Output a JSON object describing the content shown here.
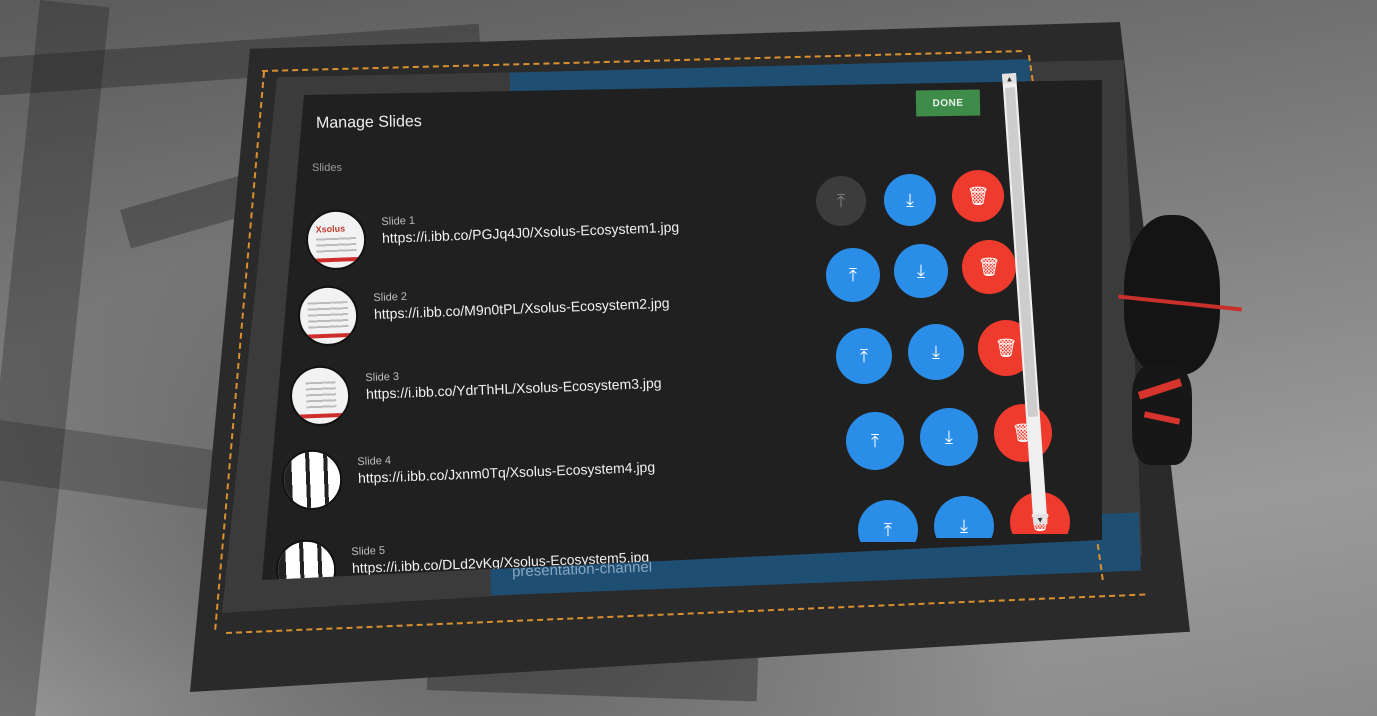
{
  "panel": {
    "title": "Manage Slides",
    "section_label": "Slides",
    "done_label": "DONE"
  },
  "channel_label": "presentation-channel",
  "slides": [
    {
      "name": "Slide 1",
      "url": "https://i.ibb.co/PGJq4J0/Xsolus-Ecosystem1.jpg",
      "move_up_enabled": false
    },
    {
      "name": "Slide 2",
      "url": "https://i.ibb.co/M9n0tPL/Xsolus-Ecosystem2.jpg",
      "move_up_enabled": true
    },
    {
      "name": "Slide 3",
      "url": "https://i.ibb.co/YdrThHL/Xsolus-Ecosystem3.jpg",
      "move_up_enabled": true
    },
    {
      "name": "Slide 4",
      "url": "https://i.ibb.co/Jxnm0Tq/Xsolus-Ecosystem4.jpg",
      "move_up_enabled": true
    },
    {
      "name": "Slide 5",
      "url": "https://i.ibb.co/DLd2vKg/Xsolus-Ecosystem5.jpg",
      "move_up_enabled": true
    }
  ],
  "thumbnails": {
    "slide1_logo_text": "Xsolus"
  },
  "icons": {
    "move_up": "arrow-to-top-icon",
    "move_down": "download-arrow-icon",
    "delete": "trash-icon"
  },
  "colors": {
    "done_green": "#3f8c4a",
    "action_blue": "#2a8de8",
    "delete_red": "#ef3b2d",
    "panel_bg": "#202020"
  }
}
